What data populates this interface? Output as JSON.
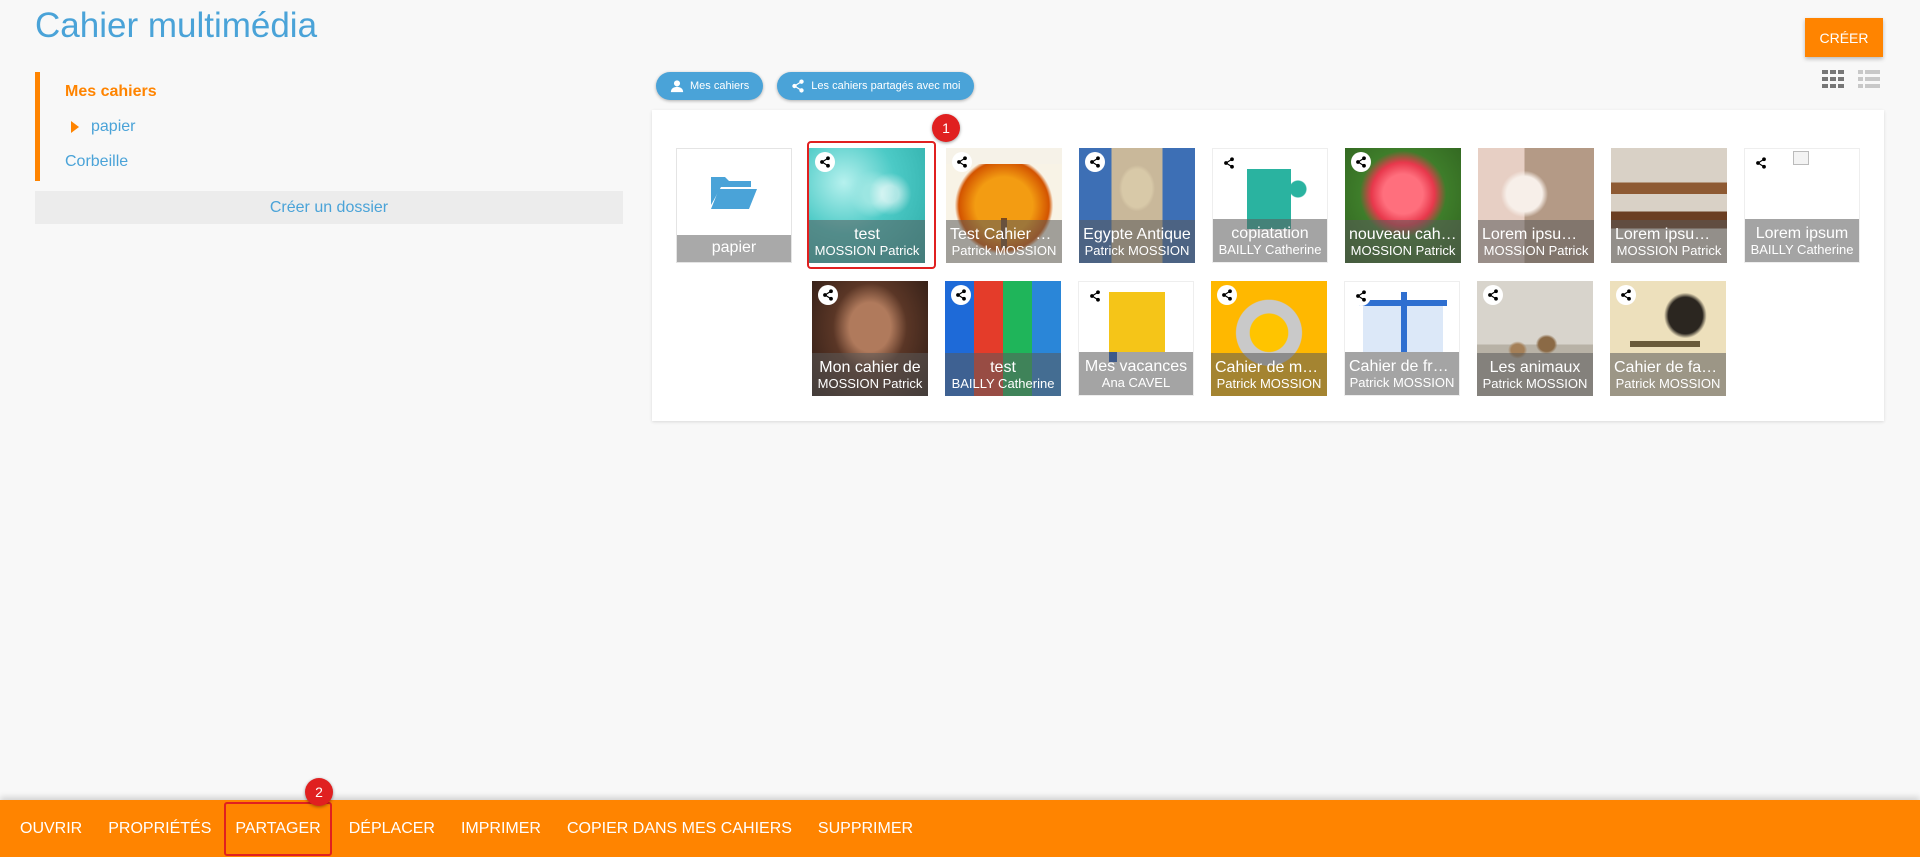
{
  "header": {
    "title": "Cahier multimédia",
    "create_label": "CRÉER"
  },
  "sidebar": {
    "items": [
      {
        "label": "Mes cahiers"
      },
      {
        "label": "papier"
      },
      {
        "label": "Corbeille"
      }
    ],
    "new_folder_label": "Créer un dossier"
  },
  "filters": {
    "mine_label": "Mes cahiers",
    "shared_label": "Les cahiers partagés avec moi"
  },
  "folder": {
    "label": "papier"
  },
  "notebooks": [
    {
      "title": "test",
      "author": "MOSSION Patrick"
    },
    {
      "title": "Test Cahier multimédia",
      "author": "Patrick MOSSION"
    },
    {
      "title": "Egypte Antique",
      "author": "Patrick MOSSION"
    },
    {
      "title": "copiatation",
      "author": "BAILLY Catherine"
    },
    {
      "title": "nouveau cahier",
      "author": "MOSSION Patrick"
    },
    {
      "title": "Lorem ipsum dolor",
      "author": "MOSSION Patrick"
    },
    {
      "title": "Lorem ipsum dolor",
      "author": "MOSSION Patrick"
    },
    {
      "title": "Lorem ipsum",
      "author": "BAILLY Catherine"
    },
    {
      "title": "Mon cahier de",
      "author": "MOSSION Patrick"
    },
    {
      "title": "test",
      "author": "BAILLY Catherine"
    },
    {
      "title": "Mes vacances",
      "author": "Ana CAVEL"
    },
    {
      "title": "Cahier de maths",
      "author": "Patrick MOSSION"
    },
    {
      "title": "Cahier de français",
      "author": "Patrick MOSSION"
    },
    {
      "title": "Les animaux",
      "author": "Patrick MOSSION"
    },
    {
      "title": "Cahier de fables",
      "author": "Patrick MOSSION"
    }
  ],
  "badges": {
    "one": "1",
    "two": "2"
  },
  "actions": [
    {
      "label": "OUVRIR"
    },
    {
      "label": "PROPRIÉTÉS"
    },
    {
      "label": "PARTAGER"
    },
    {
      "label": "DÉPLACER"
    },
    {
      "label": "IMPRIMER"
    },
    {
      "label": "COPIER DANS MES CAHIERS"
    },
    {
      "label": "SUPPRIMER"
    }
  ],
  "colors": {
    "accent": "#ff8400",
    "primary": "#4aa3d8",
    "highlight": "#e02020"
  }
}
